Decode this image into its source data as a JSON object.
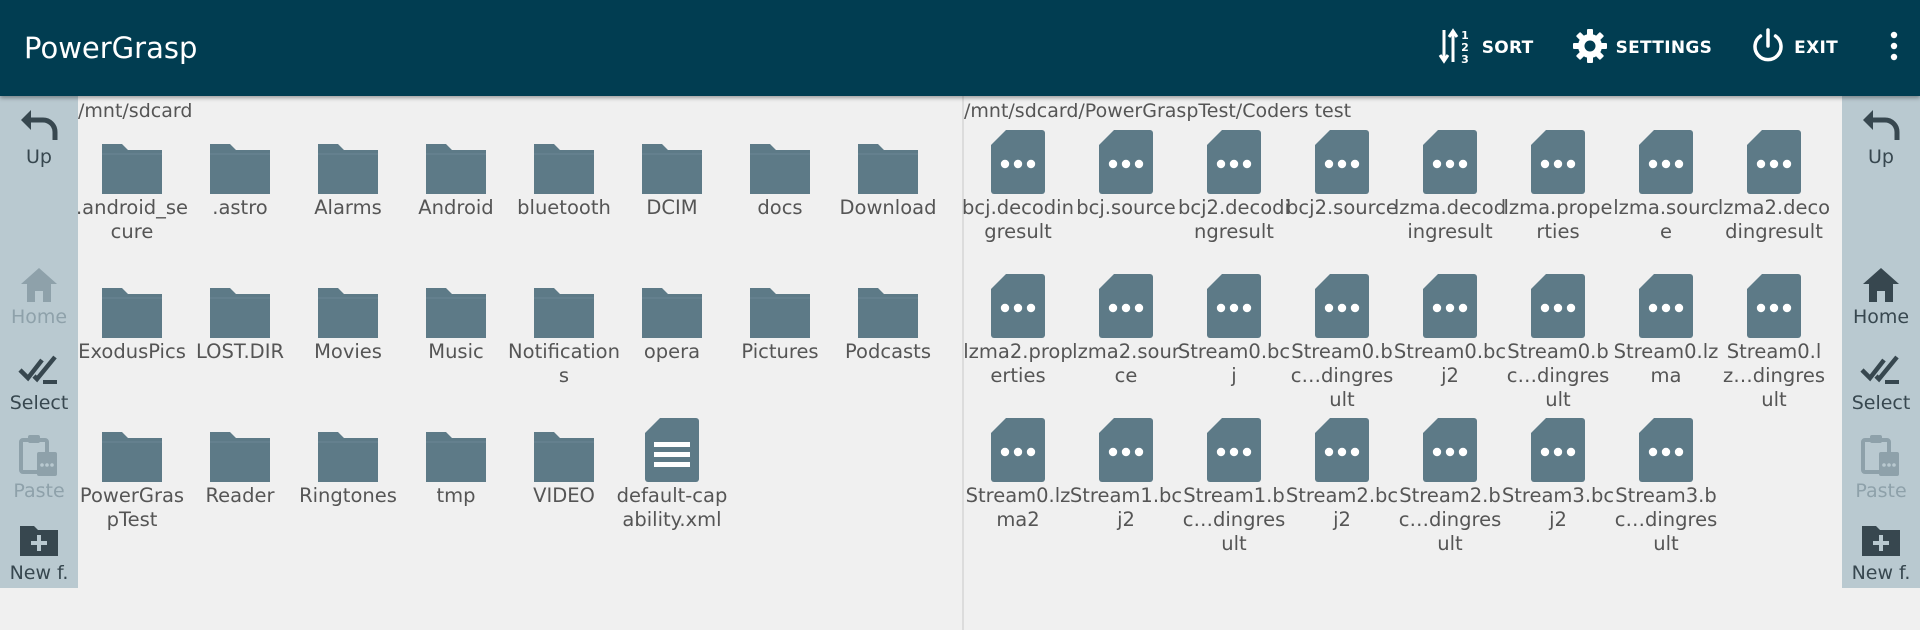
{
  "app": {
    "title": "PowerGrasp"
  },
  "toolbar": {
    "sort_label": "SORT",
    "settings_label": "SETTINGS",
    "exit_label": "EXIT",
    "sort_icon": "sort-icon",
    "settings_icon": "gear-icon",
    "exit_icon": "power-icon",
    "overflow_icon": "more-vert-icon"
  },
  "colors": {
    "appbar": "#013d51",
    "sidebar": "#b9c9d0",
    "icon": "#5d7a87",
    "background": "#f0f0f0"
  },
  "sidebar": {
    "up_label": "Up",
    "home_label": "Home",
    "select_label": "Select",
    "paste_label": "Paste",
    "new_label": "New f."
  },
  "left_pane": {
    "path": "/mnt/sdcard",
    "items": [
      {
        "name": ".android_secure",
        "type": "folder"
      },
      {
        "name": ".astro",
        "type": "folder"
      },
      {
        "name": "Alarms",
        "type": "folder"
      },
      {
        "name": "Android",
        "type": "folder"
      },
      {
        "name": "bluetooth",
        "type": "folder"
      },
      {
        "name": "DCIM",
        "type": "folder"
      },
      {
        "name": "docs",
        "type": "folder"
      },
      {
        "name": "Download",
        "type": "folder"
      },
      {
        "name": "ExodusPics",
        "type": "folder"
      },
      {
        "name": "LOST.DIR",
        "type": "folder"
      },
      {
        "name": "Movies",
        "type": "folder"
      },
      {
        "name": "Music",
        "type": "folder"
      },
      {
        "name": "Notifications",
        "type": "folder"
      },
      {
        "name": "opera",
        "type": "folder"
      },
      {
        "name": "Pictures",
        "type": "folder"
      },
      {
        "name": "Podcasts",
        "type": "folder"
      },
      {
        "name": "PowerGraspTest",
        "type": "folder"
      },
      {
        "name": "Reader",
        "type": "folder"
      },
      {
        "name": "Ringtones",
        "type": "folder"
      },
      {
        "name": "tmp",
        "type": "folder"
      },
      {
        "name": "VIDEO",
        "type": "folder"
      },
      {
        "name": "default-capability.xml",
        "type": "text"
      }
    ]
  },
  "right_pane": {
    "path": "/mnt/sdcard/PowerGraspTest/Coders test",
    "items": [
      {
        "name": "bcj.decodingresult",
        "type": "file"
      },
      {
        "name": "bcj.source",
        "type": "file"
      },
      {
        "name": "bcj2.decodingresult",
        "type": "file"
      },
      {
        "name": "bcj2.source",
        "type": "file"
      },
      {
        "name": "lzma.decodingresult",
        "type": "file"
      },
      {
        "name": "lzma.properties",
        "type": "file"
      },
      {
        "name": "lzma.source",
        "type": "file"
      },
      {
        "name": "lzma2.decodingresult",
        "type": "file"
      },
      {
        "name": "lzma2.properties",
        "type": "file"
      },
      {
        "name": "lzma2.source",
        "type": "file"
      },
      {
        "name": "Stream0.bcj",
        "type": "file"
      },
      {
        "name": "Stream0.bc…dingresult",
        "type": "file"
      },
      {
        "name": "Stream0.bcj2",
        "type": "file"
      },
      {
        "name": "Stream0.bc…dingresult",
        "type": "file"
      },
      {
        "name": "Stream0.lzma",
        "type": "file"
      },
      {
        "name": "Stream0.lz…dingresult",
        "type": "file"
      },
      {
        "name": "Stream0.lzma2",
        "type": "file"
      },
      {
        "name": "Stream1.bcj2",
        "type": "file"
      },
      {
        "name": "Stream1.bc…dingresult",
        "type": "file"
      },
      {
        "name": "Stream2.bcj2",
        "type": "file"
      },
      {
        "name": "Stream2.bc…dingresult",
        "type": "file"
      },
      {
        "name": "Stream3.bcj2",
        "type": "file"
      },
      {
        "name": "Stream3.bc…dingresult",
        "type": "file"
      }
    ]
  }
}
